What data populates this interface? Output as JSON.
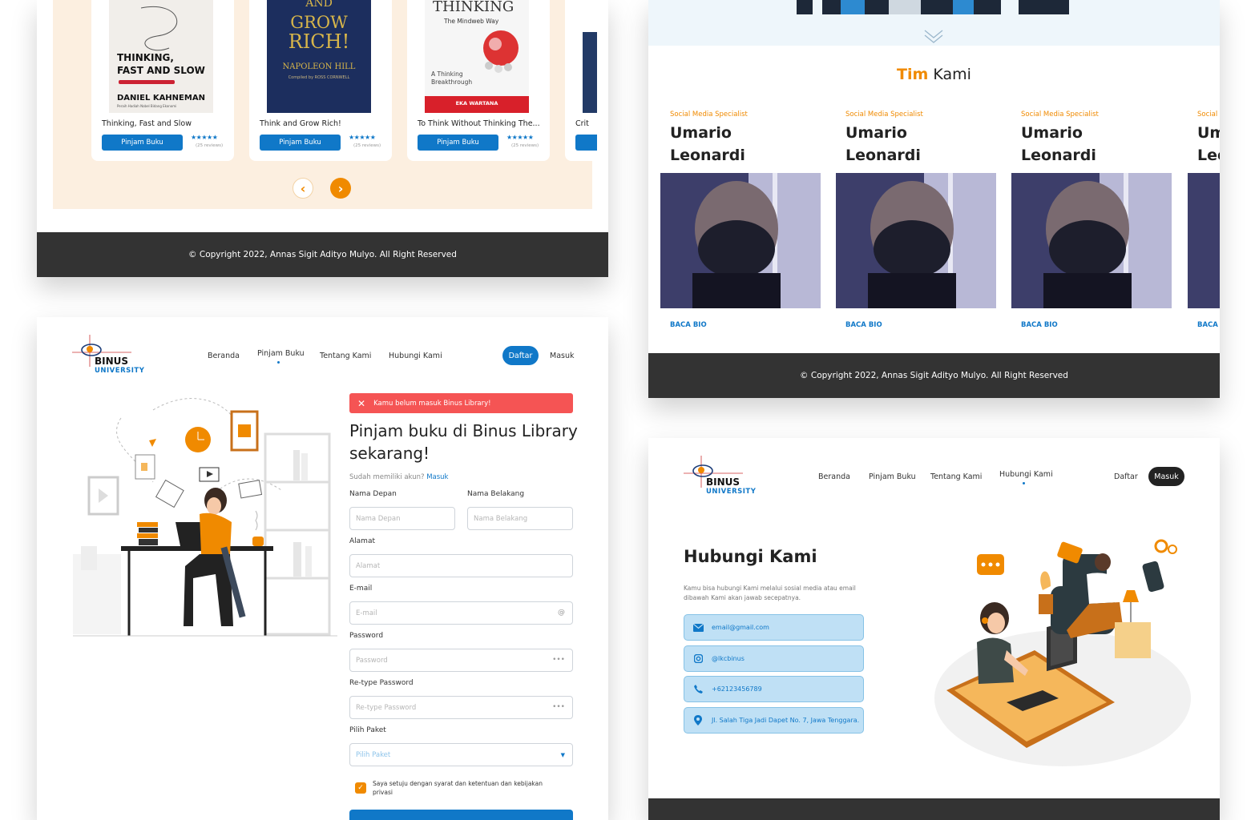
{
  "books_panel": {
    "books": [
      {
        "title": "Thinking, Fast and Slow",
        "cover_lines": [
          "THINKING,",
          "FAST AND SLOW"
        ],
        "author": "DANIEL KAHNEMAN",
        "author_sub": "Peraih Hadiah Nobel Bidang Ekonomi",
        "button": "Pinjam Buku",
        "stars": "★★★★★",
        "reviews": "(25 reviews)"
      },
      {
        "title": "Think and Grow Rich!",
        "cover_lines": [
          "AND",
          "GROW",
          "RICH!"
        ],
        "author": "NAPOLEON HILL",
        "author_sub": "Compiled by ROSS CORNWELL",
        "button": "Pinjam Buku",
        "stars": "★★★★★",
        "reviews": "(25 reviews)"
      },
      {
        "title": "To Think Without Thinking The...",
        "cover_lines": [
          "THINKING",
          "The Mindweb Way"
        ],
        "author": "EKA WARTANA",
        "author_sub": "A Thinking Breakthrough",
        "button": "Pinjam Buku",
        "stars": "★★★★★",
        "reviews": "(25 reviews)"
      },
      {
        "title": "Crit",
        "button": "",
        "stars": "",
        "reviews": ""
      }
    ],
    "prev_icon": "‹",
    "next_icon": "›",
    "footer": "© Copyright 2022, Annas Sigit Adityo Mulyo. All Right Reserved"
  },
  "team_panel": {
    "title_accent": "Tim",
    "title_rest": " Kami",
    "members": [
      {
        "role": "Social Media Specialist",
        "first": "Umario",
        "last": "Leonardi",
        "link": "BACA BIO"
      },
      {
        "role": "Social Media Specialist",
        "first": "Umario",
        "last": "Leonardi",
        "link": "BACA BIO"
      },
      {
        "role": "Social Media Specialist",
        "first": "Umario",
        "last": "Leonardi",
        "link": "BACA BIO"
      },
      {
        "role": "Social",
        "first": "Um",
        "last": "Leo",
        "link": "BACA"
      }
    ],
    "footer": "© Copyright 2022, Annas Sigit Adityo Mulyo. All Right Reserved"
  },
  "brand": {
    "name": "BINUS",
    "sub": "UNIVERSITY"
  },
  "register_panel": {
    "nav": [
      "Beranda",
      "Pinjam Buku",
      "Tentang Kami",
      "Hubungi Kami"
    ],
    "daftar": "Daftar",
    "masuk": "Masuk",
    "alert": "Kamu belum masuk Binus Library!",
    "heading": "Pinjam buku di Binus Library sekarang!",
    "have_account": "Sudah memiliki akun?",
    "login_link": "Masuk",
    "labels": {
      "first_name": "Nama Depan",
      "last_name": "Nama Belakang",
      "address": "Alamat",
      "email": "E-mail",
      "password": "Password",
      "retype": "Re-type Password",
      "package": "Pilih Paket"
    },
    "placeholders": {
      "first_name": "Nama Depan",
      "last_name": "Nama Belakang",
      "address": "Alamat",
      "email": "E-mail",
      "password": "Password",
      "retype": "Re-type Password",
      "package": "Pilih Paket"
    },
    "agree": "Saya setuju dengan syarat dan ketentuan dan kebijakan privasi"
  },
  "contact_panel": {
    "nav": [
      "Beranda",
      "Pinjam Buku",
      "Tentang Kami",
      "Hubungi Kami"
    ],
    "daftar": "Daftar",
    "masuk": "Masuk",
    "heading": "Hubungi Kami",
    "desc": "Kamu bisa hubungi Kami melalui sosial media atau email dibawah Kami akan jawab secepatnya.",
    "items": [
      {
        "icon": "mail-icon",
        "text": "email@gmail.com"
      },
      {
        "icon": "instagram-icon",
        "text": "@lkcbinus"
      },
      {
        "icon": "phone-icon",
        "text": "+62123456789"
      },
      {
        "icon": "location-icon",
        "text": "Jl. Salah Tiga Jadi Dapet No. 7, Jawa Tenggara."
      }
    ]
  },
  "colors": {
    "accent_blue": "#1078c8",
    "accent_orange": "#f08a00",
    "footer_dark": "#333333",
    "alert_red": "#f55454"
  }
}
